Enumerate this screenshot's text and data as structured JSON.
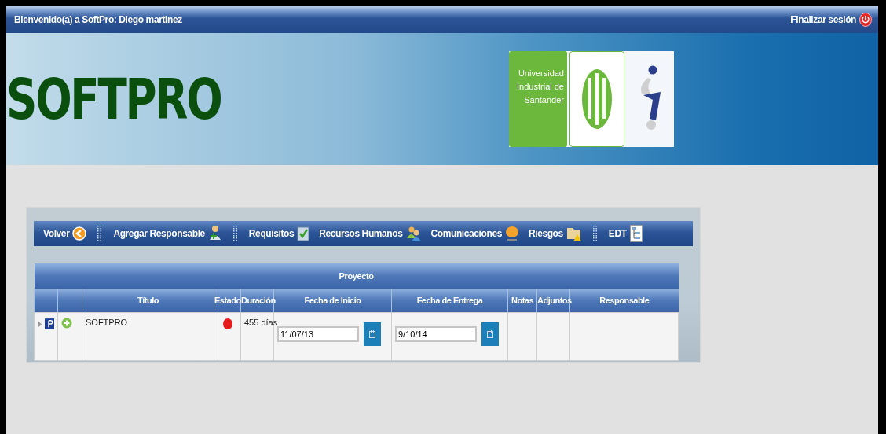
{
  "top_bar": {
    "welcome": "Bienvenido(a) a SoftPro: Diego martinez",
    "logout": "Finalizar sesión"
  },
  "header": {
    "title": "SOFTPRO",
    "university_lines": [
      "Universidad",
      "Industrial de",
      "Santander"
    ]
  },
  "toolbar": [
    {
      "kind": "button",
      "label": "Volver"
    },
    {
      "kind": "grip"
    },
    {
      "kind": "button",
      "label": "Agregar Responsable"
    },
    {
      "kind": "grip"
    },
    {
      "kind": "button",
      "label": "Requisitos"
    },
    {
      "kind": "button",
      "label": "Recursos Humanos"
    },
    {
      "kind": "button",
      "label": "Comunicaciones"
    },
    {
      "kind": "button",
      "label": "Riesgos"
    },
    {
      "kind": "grip"
    },
    {
      "kind": "button",
      "label": "EDT"
    }
  ],
  "table": {
    "title": "Proyecto",
    "columns": [
      {},
      {},
      {
        "label": "Título"
      },
      {
        "label": "Estado"
      },
      {
        "label": "Duración"
      },
      {
        "label": "Fecha de Inicio"
      },
      {
        "label": "Fecha de Entrega"
      },
      {
        "label": "Notas"
      },
      {
        "label": "Adjuntos"
      },
      {
        "label": "Responsable"
      }
    ],
    "rows": [
      {
        "expanded": false,
        "title": "SOFTPRO",
        "color": "#e31b1b",
        "duration": "455 días",
        "start_date": "11/07/13",
        "end_date": "9/10/14"
      }
    ]
  }
}
